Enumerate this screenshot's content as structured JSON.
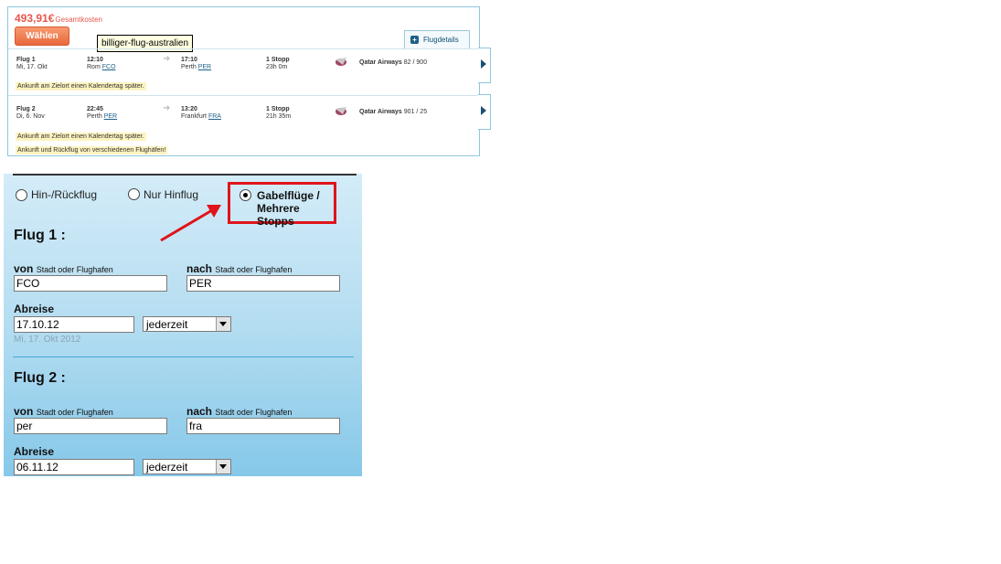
{
  "result": {
    "price": "493,91€",
    "price_label": "Gesamtkosten",
    "choose_label": "Wählen",
    "tooltip": "billiger-flug-australien",
    "details_label": "Flugdetails",
    "legs": [
      {
        "title": "Flug 1",
        "date": "Mi, 17. Okt",
        "dep_time": "12:10",
        "dep_city": "Rom",
        "dep_code": "FCO",
        "arr_time": "17:10",
        "arr_city": "Perth",
        "arr_code": "PER",
        "stops": "1 Stopp",
        "duration": "23h 0m",
        "airline": "Qatar Airways",
        "flight_no": "82 / 900",
        "notices": [
          "Ankunft am Zielort einen Kalendertag später."
        ]
      },
      {
        "title": "Flug 2",
        "date": "Di, 6. Nov",
        "dep_time": "22:45",
        "dep_city": "Perth",
        "dep_code": "PER",
        "arr_time": "13:20",
        "arr_city": "Frankfurt",
        "arr_code": "FRA",
        "stops": "1 Stopp",
        "duration": "21h 35m",
        "airline": "Qatar Airways",
        "flight_no": "901 / 25",
        "notices": [
          "Ankunft am Zielort einen Kalendertag später.",
          "Ankunft und Rückflug von verschiedenen Flughäfen!"
        ]
      }
    ]
  },
  "search": {
    "trip_types": [
      {
        "label": "Hin-/Rückflug",
        "selected": false
      },
      {
        "label": "Nur Hinflug",
        "selected": false
      },
      {
        "label_line1": "Gabelflüge /",
        "label_line2": "Mehrere Stopps",
        "selected": true
      }
    ],
    "flights": [
      {
        "heading": "Flug 1 :",
        "from_label": "von",
        "from_sub": "Stadt oder Flughafen",
        "from_value": "FCO",
        "to_label": "nach",
        "to_sub": "Stadt oder Flughafen",
        "to_value": "PER",
        "depart_label": "Abreise",
        "depart_value": "17.10.12",
        "time_value": "jederzeit",
        "date_hint": "Mi, 17. Okt 2012"
      },
      {
        "heading": "Flug 2 :",
        "from_label": "von",
        "from_sub": "Stadt oder Flughafen",
        "from_value": "per",
        "to_label": "nach",
        "to_sub": "Stadt oder Flughafen",
        "to_value": "fra",
        "depart_label": "Abreise",
        "depart_value": "06.11.12",
        "time_value": "jederzeit"
      }
    ]
  },
  "colors": {
    "price": "#e8564b",
    "choose_button": "#f08050",
    "highlight_box": "#e0141b",
    "annotation_arrow": "#e0141b",
    "panel_bg": "#b4ddf1"
  }
}
